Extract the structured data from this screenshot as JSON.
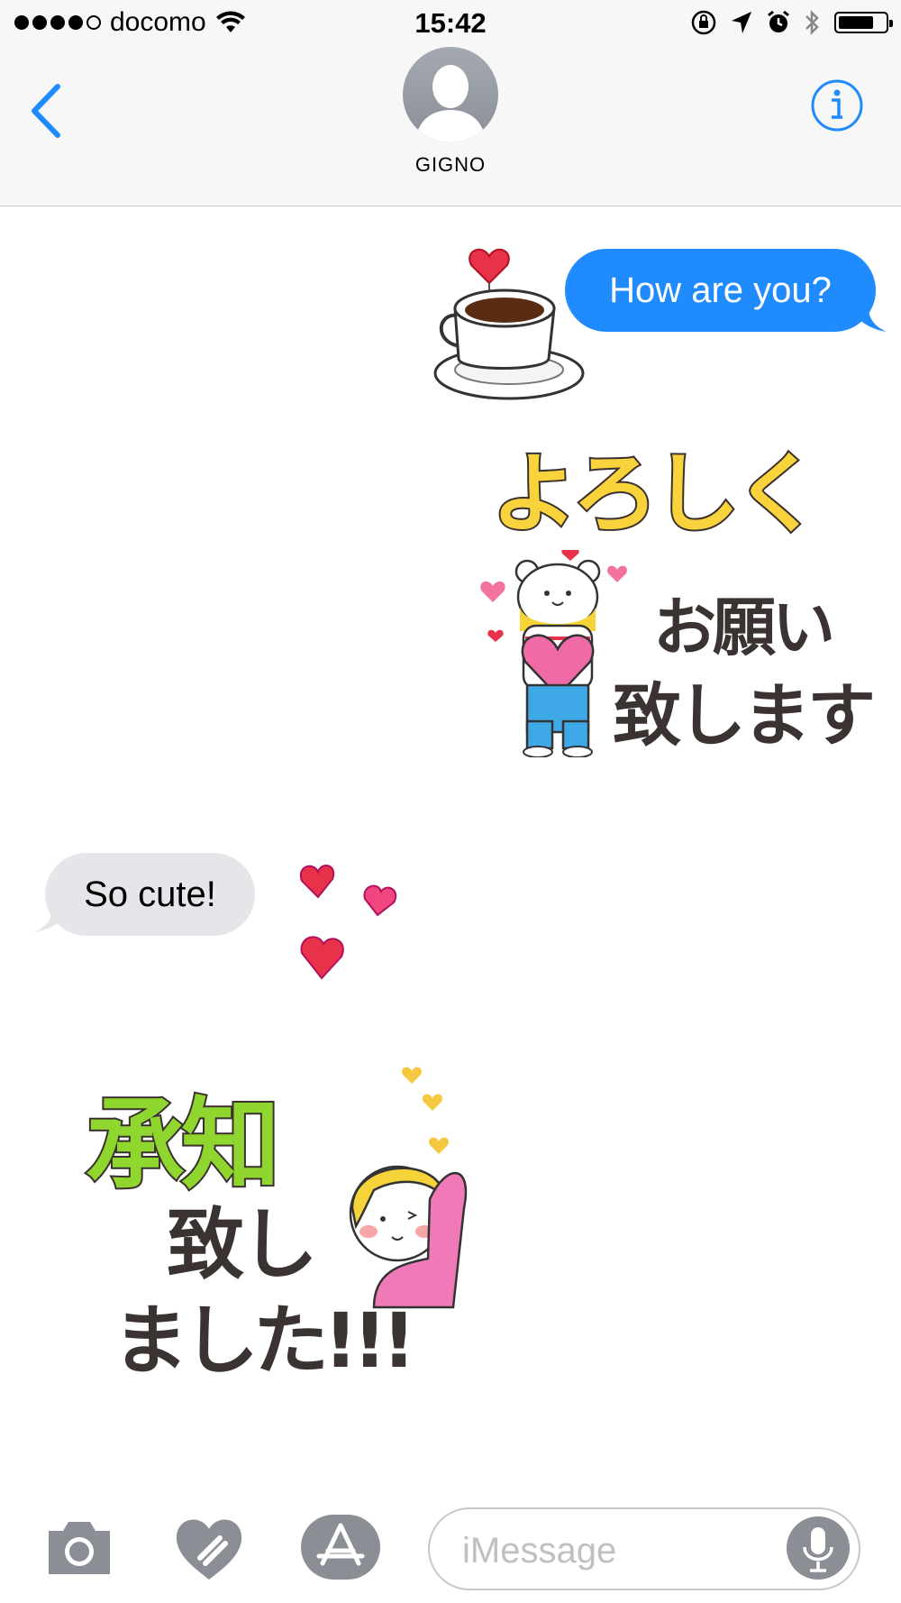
{
  "status_bar": {
    "carrier": "docomo",
    "time": "15:42",
    "battery_level": 0.75,
    "signal_bars": 4
  },
  "header": {
    "contact_name": "GIGNO"
  },
  "messages": [
    {
      "type": "sent",
      "text": "How are you?"
    },
    {
      "type": "received",
      "text": "So cute!"
    }
  ],
  "stickers": {
    "yoroshiku": {
      "line1": "よろしく",
      "line2": "お願い",
      "line3": "致します"
    },
    "shouchi": {
      "line1": "承知",
      "line2": "致し",
      "line3": "ました!!!"
    }
  },
  "composer": {
    "placeholder": "iMessage"
  },
  "colors": {
    "accent": "#1f8bff",
    "received_bubble": "#e5e5ea",
    "heart": "#e8324a"
  }
}
